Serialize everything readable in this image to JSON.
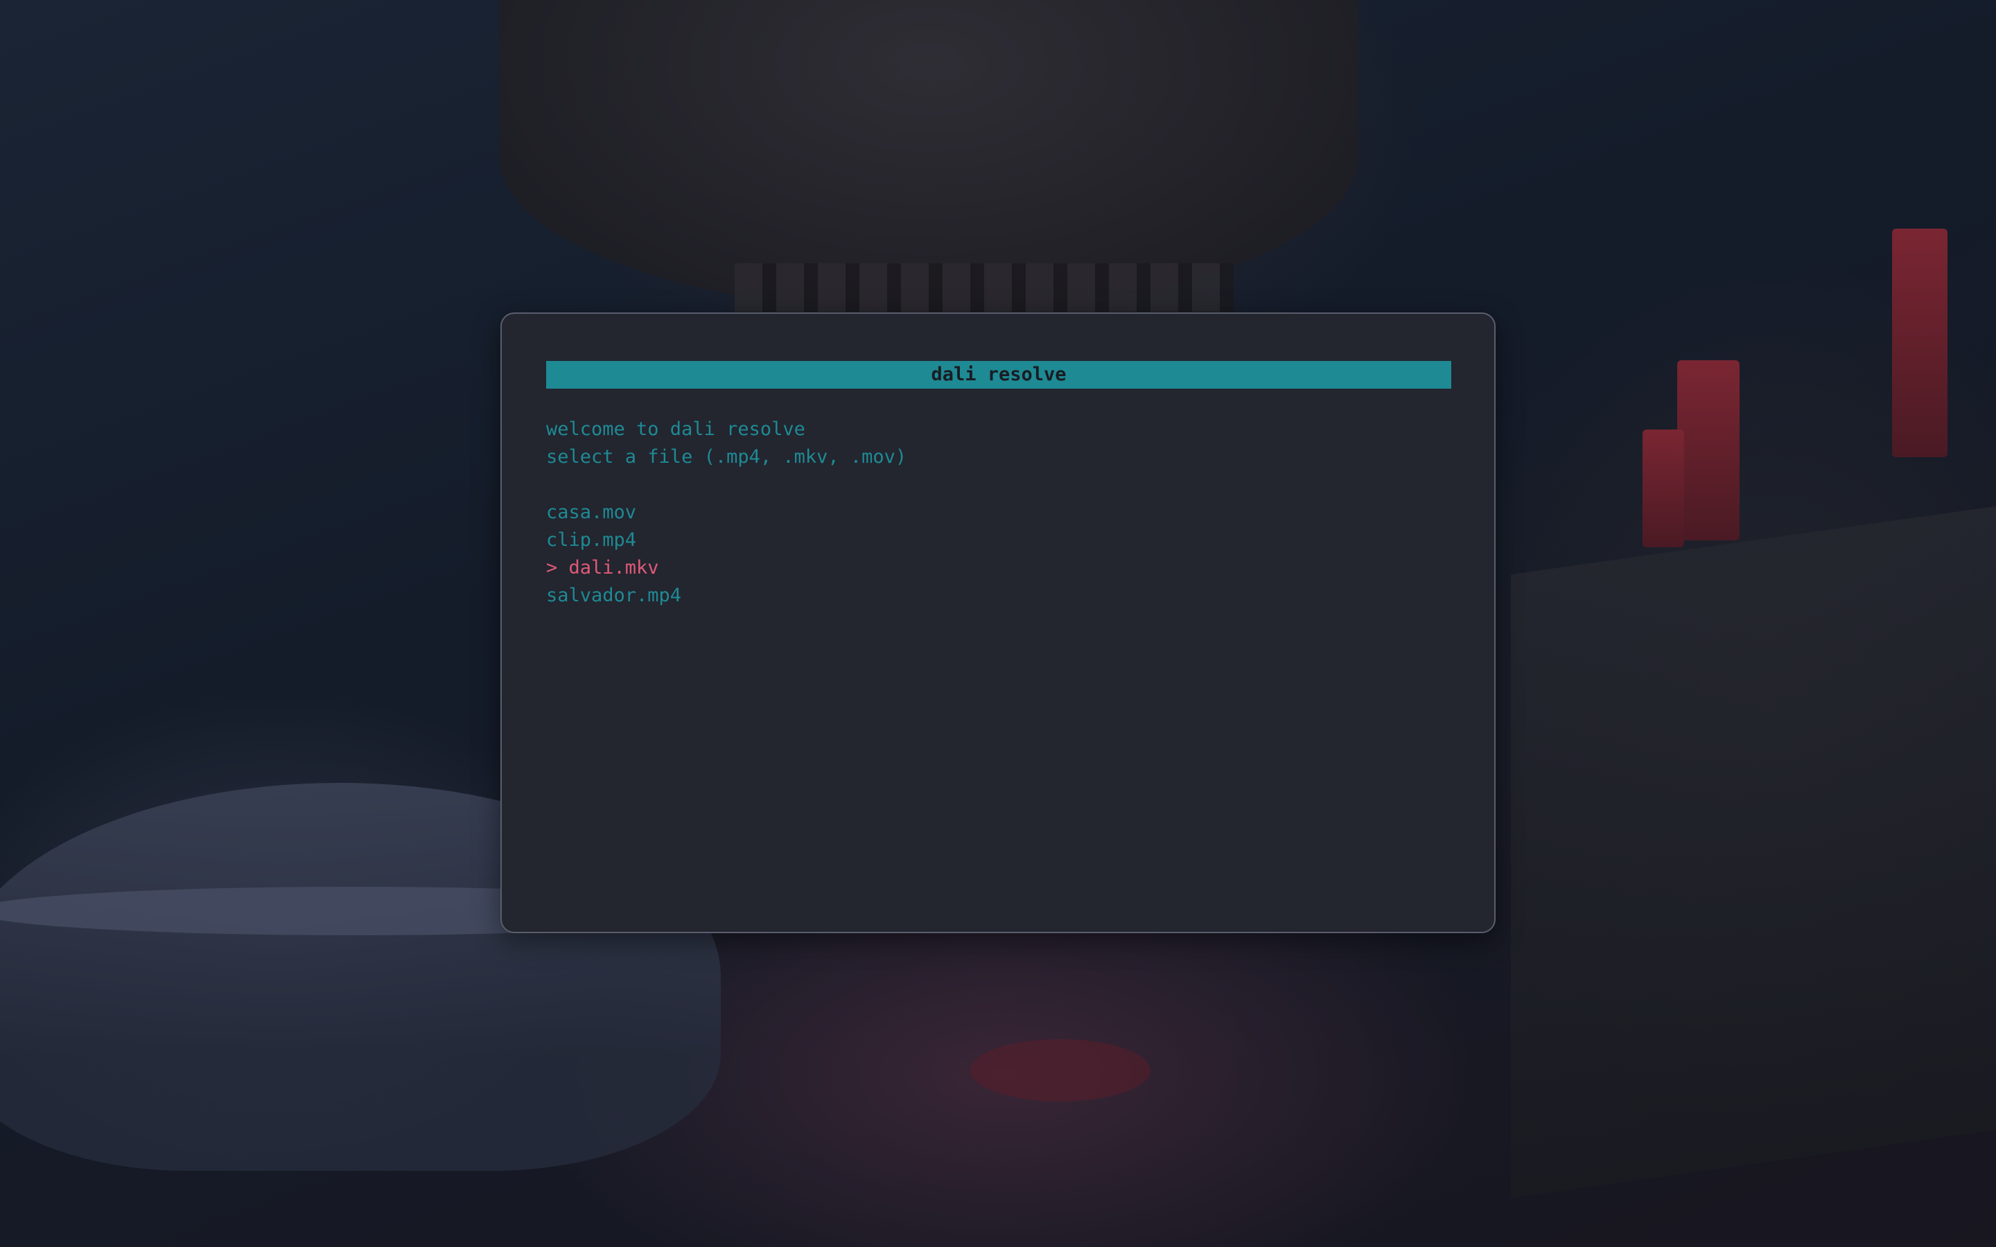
{
  "app": {
    "title": "dali resolve"
  },
  "intro": {
    "welcome": "welcome to dali resolve",
    "prompt": "select a file (.mp4, .mkv, .mov)"
  },
  "files": [
    {
      "label": "casa.mov",
      "selected": false
    },
    {
      "label": "clip.mp4",
      "selected": false
    },
    {
      "label": "> dali.mkv",
      "selected": true
    },
    {
      "label": "salvador.mp4",
      "selected": false
    }
  ],
  "colors": {
    "accent": "#1e8a94",
    "selected": "#e05a77",
    "window_bg": "#23252f",
    "window_border": "#5a5e6c"
  }
}
